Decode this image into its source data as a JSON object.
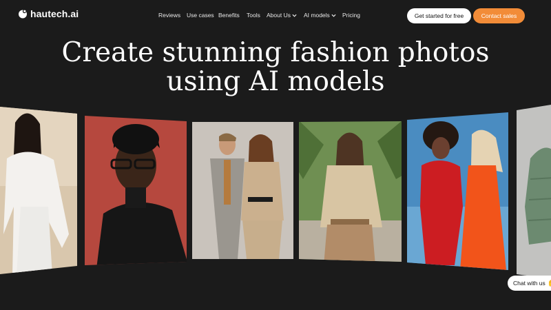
{
  "brand": {
    "name": "hautech.ai",
    "icon": "hautech-logo-icon"
  },
  "nav": {
    "items": [
      {
        "label": "Reviews",
        "dropdown": false
      },
      {
        "label": "Use cases",
        "dropdown": false
      },
      {
        "label": "Benefits",
        "dropdown": false
      },
      {
        "label": "Tools",
        "dropdown": false
      },
      {
        "label": "About Us",
        "dropdown": true
      },
      {
        "label": "AI models",
        "dropdown": true
      },
      {
        "label": "Pricing",
        "dropdown": false
      }
    ]
  },
  "actions": {
    "get_started": "Get started for free",
    "contact_sales": "Contact sales"
  },
  "hero": {
    "line1": "Create stunning fashion photos",
    "line2": "using AI models"
  },
  "gallery": {
    "cards": [
      {
        "name": "photo-model-white-blouse"
      },
      {
        "name": "photo-model-black-turtleneck"
      },
      {
        "name": "photo-couple-suits"
      },
      {
        "name": "photo-model-beige-shirt"
      },
      {
        "name": "photo-models-red-orange-dresses"
      },
      {
        "name": "photo-green-puffer-jacket"
      }
    ]
  },
  "chat": {
    "label": "Chat with us",
    "icon": "wave-hand-icon"
  },
  "colors": {
    "background": "#1b1b1b",
    "accent": "#f28c38",
    "button_light": "#ffffff"
  }
}
